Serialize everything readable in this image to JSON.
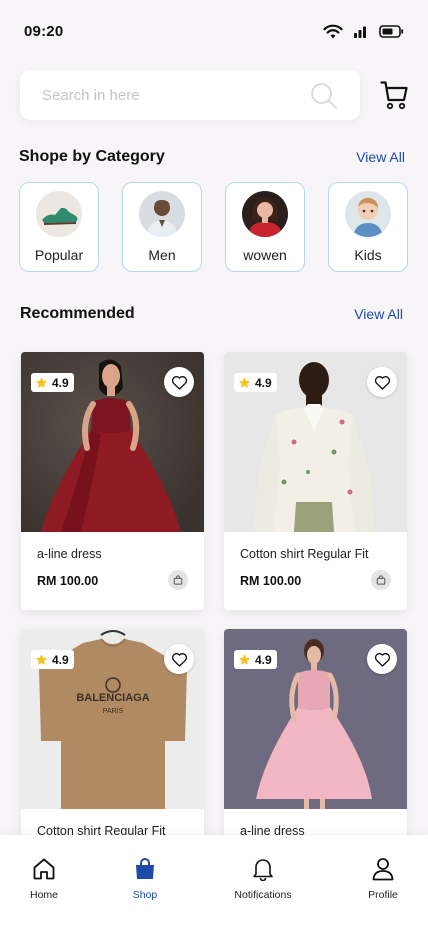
{
  "status": {
    "time": "09:20"
  },
  "search": {
    "placeholder": "Search in here"
  },
  "categories_section": {
    "title": "Shope by Category",
    "view_all": "View All",
    "items": [
      {
        "label": "Popular",
        "icon": "shoe-image"
      },
      {
        "label": "Men",
        "icon": "man-avatar-image"
      },
      {
        "label": "wowen",
        "icon": "woman-avatar-image"
      },
      {
        "label": "Kids",
        "icon": "kid-avatar-image"
      }
    ]
  },
  "recommended": {
    "title": "Recommended",
    "view_all": "View All",
    "products": [
      {
        "name": "a-line dress",
        "price": "RM 100.00",
        "rating": "4.9"
      },
      {
        "name": "Cotton shirt Regular Fit",
        "price": "RM 100.00",
        "rating": "4.9"
      },
      {
        "name": "Cotton shirt Regular Fit",
        "price": "",
        "rating": "4.9",
        "print": "BALENCIAGA",
        "print_sub": "PARIS"
      },
      {
        "name": "a-line  dress",
        "price": "",
        "rating": "4.9"
      }
    ]
  },
  "nav": {
    "items": [
      {
        "label": "Home",
        "icon": "home-icon"
      },
      {
        "label": "Shop",
        "icon": "shopping-bag-icon",
        "active": true
      },
      {
        "label": "Notifications",
        "icon": "bell-icon"
      },
      {
        "label": "Profile",
        "icon": "user-icon"
      }
    ]
  },
  "colors": {
    "accent": "#1e4aa8",
    "star": "#f6c21c",
    "border": "#b7d6ee"
  }
}
